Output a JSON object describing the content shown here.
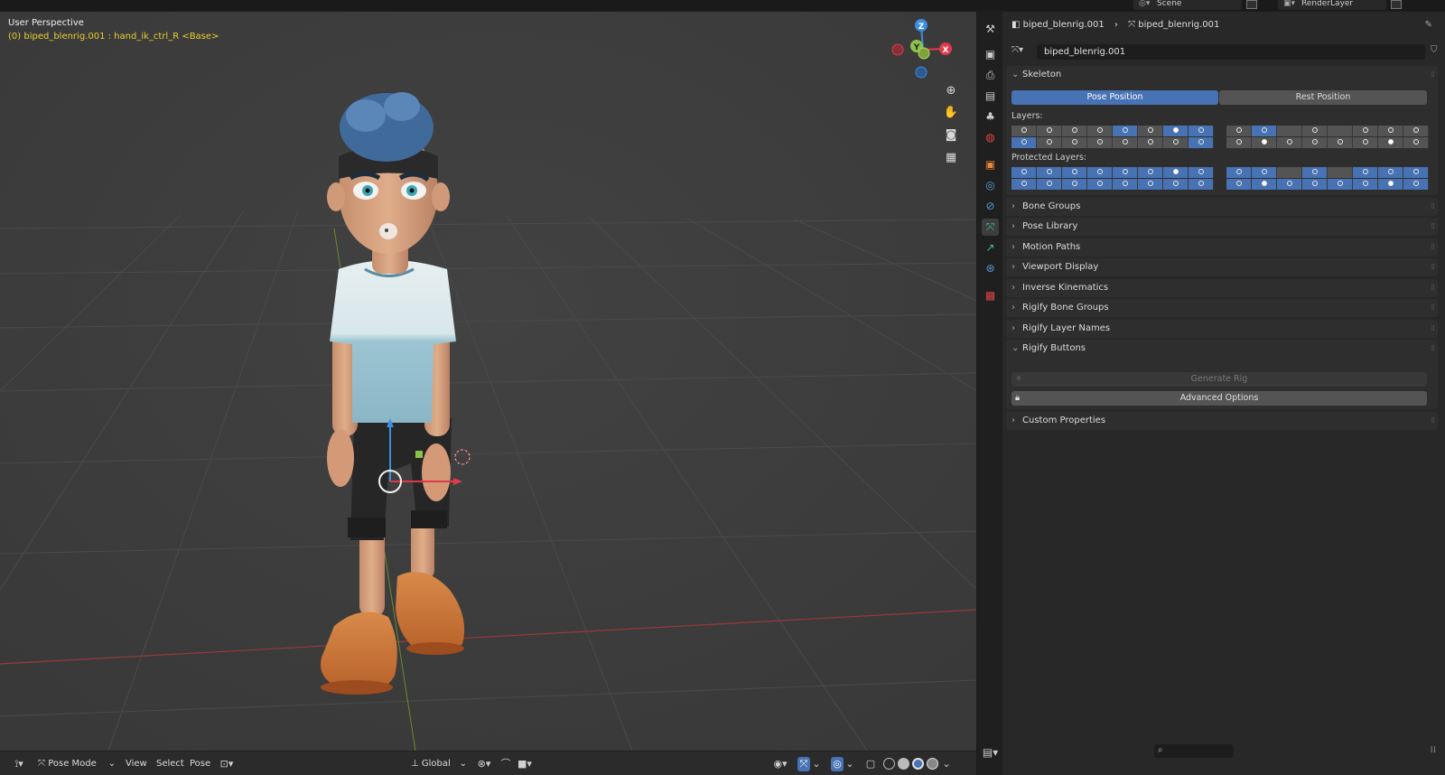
{
  "topbar": {
    "scene": "Scene",
    "render_layer": "RenderLayer"
  },
  "viewport": {
    "title": "User Perspective",
    "subtitle": "(0) biped_blenrig.001 : hand_ik_ctrl_R <Base>",
    "gizmo": {
      "z": "Z",
      "y": "Y",
      "x": "X"
    },
    "header": {
      "mode": "Pose Mode",
      "menus": [
        "View",
        "Select",
        "Pose"
      ],
      "orientation": "Global"
    }
  },
  "properties": {
    "breadcrumb": {
      "object": "biped_blenrig.001",
      "data": "biped_blenrig.001"
    },
    "armature_name": "biped_blenrig.001",
    "skeleton": {
      "label": "Skeleton",
      "pose_position": "Pose Position",
      "rest_position": "Rest Position",
      "active_position": "pose",
      "layers_label": "Layers:",
      "protected_label": "Protected Layers:",
      "layers": {
        "left": {
          "row1": [
            "o",
            "o",
            "o",
            "o",
            "O",
            "o",
            "D",
            "O"
          ],
          "row2": [
            "O",
            "o",
            "o",
            "o",
            "o",
            "o",
            "o",
            "O"
          ]
        },
        "right": {
          "row1": [
            "o",
            "O",
            "-",
            "o",
            "-",
            "o",
            "o",
            "o"
          ],
          "row2": [
            "o",
            "d",
            "o",
            "o",
            "o",
            "o",
            "d",
            "o"
          ]
        }
      },
      "protected": {
        "left": {
          "row1": [
            "O",
            "O",
            "O",
            "O",
            "O",
            "O",
            "D",
            "O"
          ],
          "row2": [
            "O",
            "O",
            "O",
            "O",
            "O",
            "O",
            "O",
            "O"
          ]
        },
        "right": {
          "row1": [
            "O",
            "O",
            "-",
            "O",
            "-",
            "O",
            "O",
            "O"
          ],
          "row2": [
            "O",
            "D",
            "O",
            "O",
            "O",
            "O",
            "D",
            "O"
          ]
        }
      }
    },
    "panels": [
      "Bone Groups",
      "Pose Library",
      "Motion Paths",
      "Viewport Display",
      "Inverse Kinematics",
      "Rigify Bone Groups",
      "Rigify Layer Names"
    ],
    "rigify_buttons": {
      "label": "Rigify Buttons",
      "generate": "Generate Rig",
      "advanced": "Advanced Options"
    },
    "custom_properties": "Custom Properties"
  },
  "colors": {
    "accent": "#4772b3",
    "x_axis": "#e0394c",
    "y_axis": "#8bc34a",
    "z_axis": "#3b8ee0",
    "active_text": "#e8d030"
  }
}
